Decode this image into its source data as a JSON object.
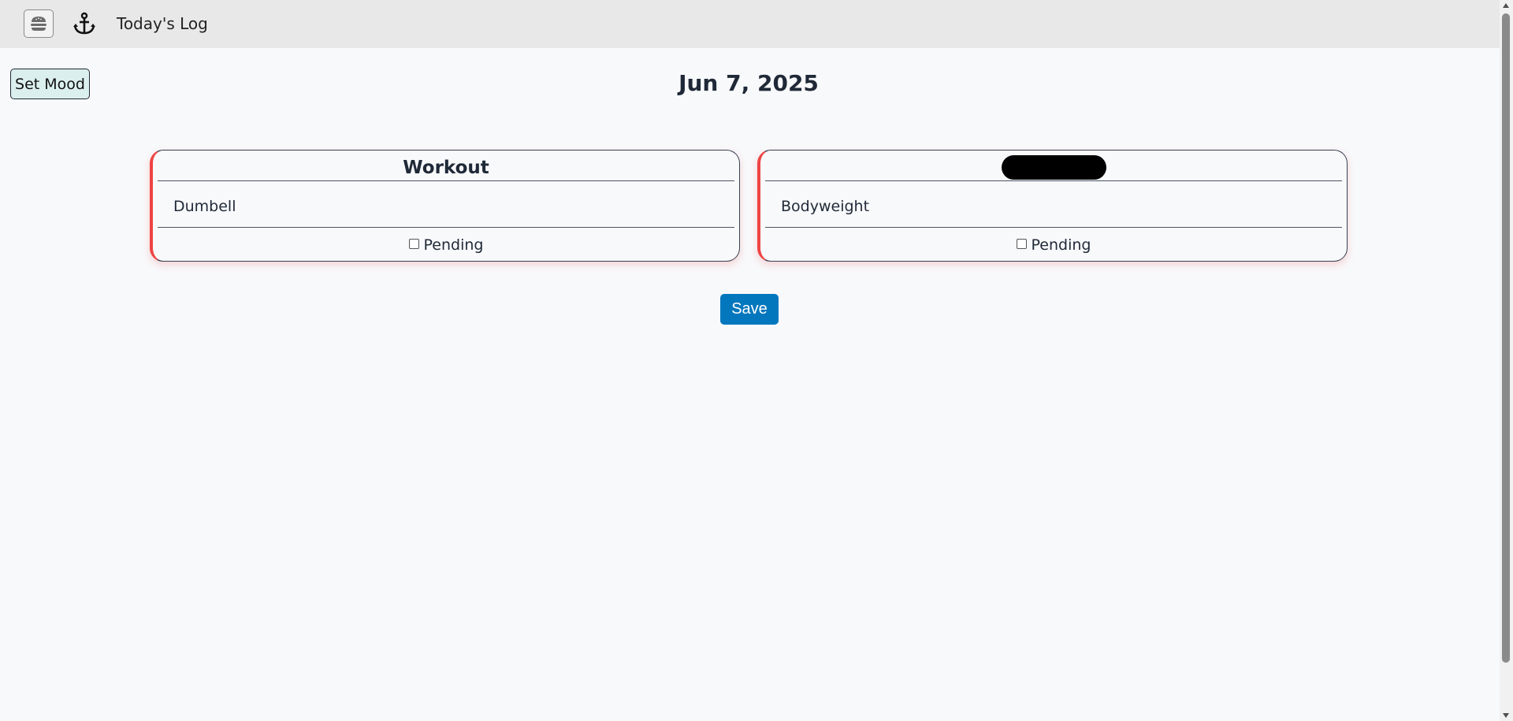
{
  "header": {
    "title": "Today's Log",
    "menu_icon": "hamburger-menu-icon",
    "logo_icon": "anchor-icon",
    "background": "#e8e8e8"
  },
  "mood_button": {
    "label": "Set Mood",
    "background": "#dcefef"
  },
  "date": "Jun 7, 2025",
  "cards": [
    {
      "title": "Workout",
      "title_redacted": false,
      "body": "Dumbell",
      "status_label": "Pending",
      "checked": false
    },
    {
      "title": "",
      "title_redacted": true,
      "body": "Bodyweight",
      "status_label": "Pending",
      "checked": false
    }
  ],
  "save_button": {
    "label": "Save",
    "background": "#0277bd"
  },
  "colors": {
    "card_accent": "#ef4444",
    "page_background": "#f8f9fb",
    "text": "#1f2937"
  }
}
